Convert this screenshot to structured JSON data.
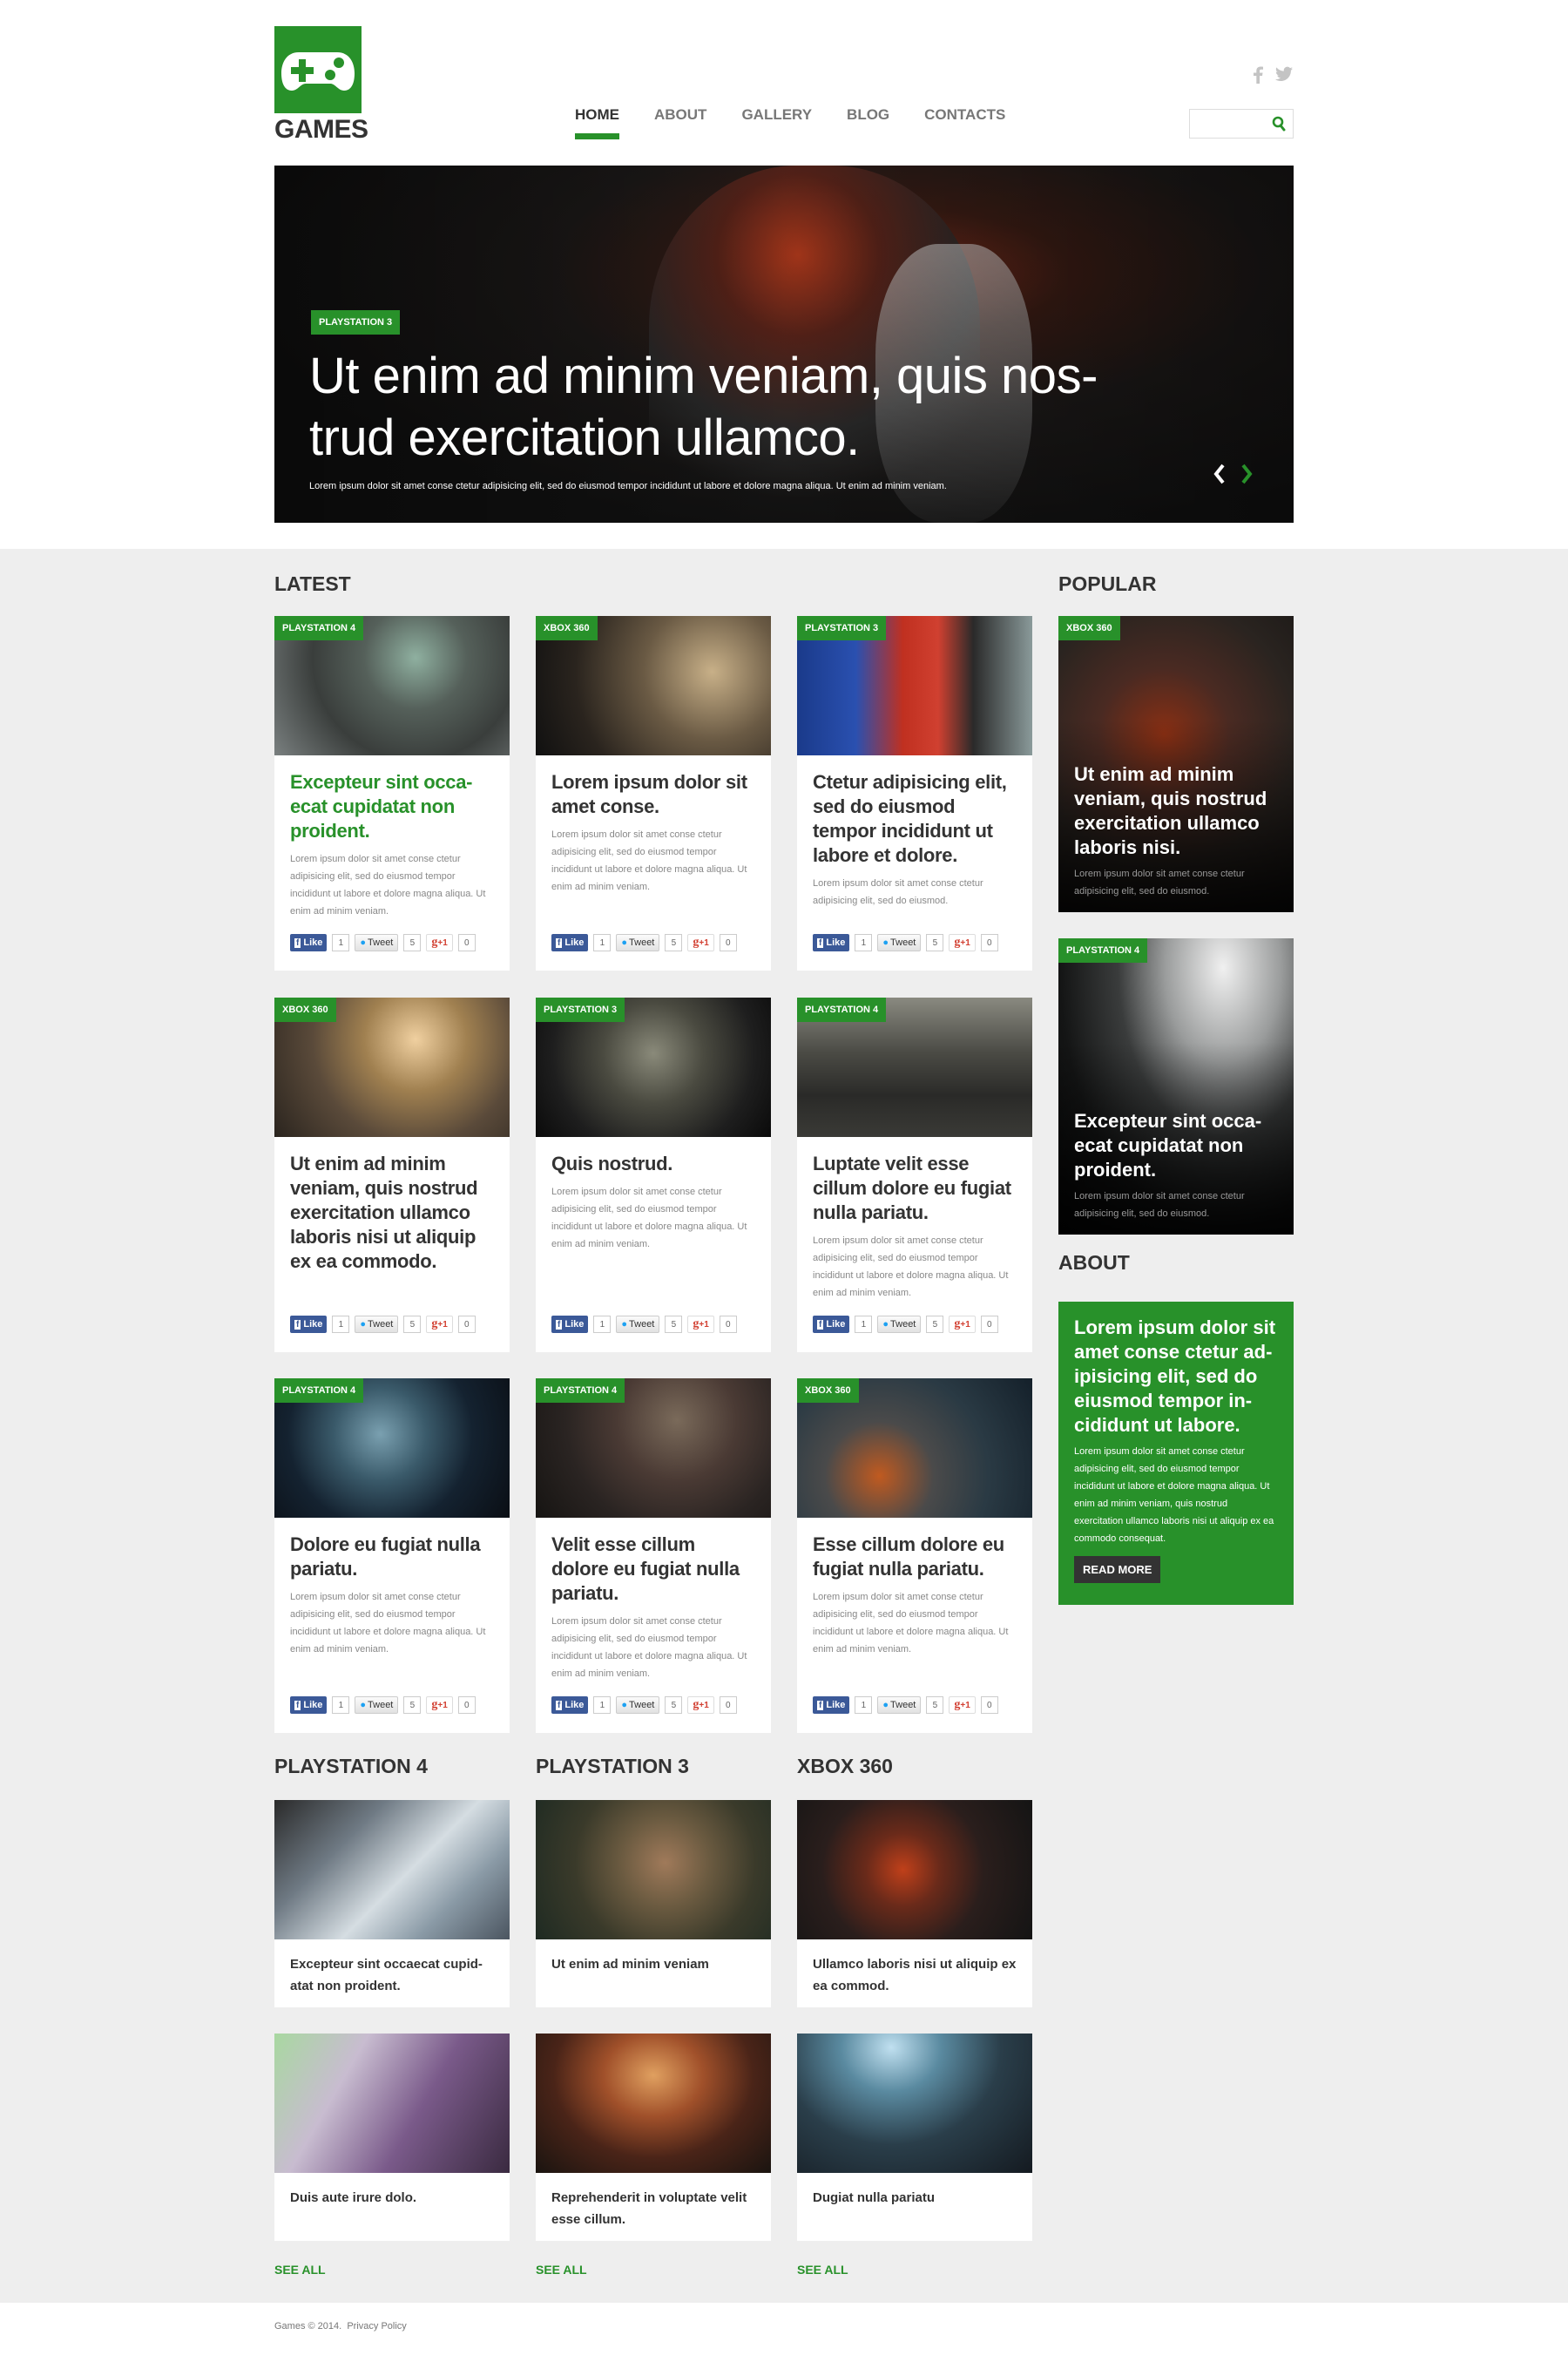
{
  "brand": {
    "name": "GAMES",
    "logo_icon": "gamepad-icon",
    "accent_color": "#28912a"
  },
  "nav": {
    "items": [
      {
        "label": "HOME",
        "active": true
      },
      {
        "label": "ABOUT",
        "active": false
      },
      {
        "label": "GALLERY",
        "active": false
      },
      {
        "label": "BLOG",
        "active": false
      },
      {
        "label": "CONTACTS",
        "active": false
      }
    ]
  },
  "social": [
    {
      "icon": "facebook-icon",
      "glyph": "f"
    },
    {
      "icon": "twitter-icon",
      "glyph": "t"
    }
  ],
  "search": {
    "value": "",
    "placeholder": "",
    "icon": "search-icon"
  },
  "hero": {
    "badge": "PLAYSTATION 3",
    "title": "Ut enim ad minim veniam, quis nos-trud exercitation ullamco.",
    "title_line1": "Ut enim ad minim veniam, quis nos-",
    "title_line2": "trud exercitation ullamco.",
    "subtitle": "Lorem ipsum dolor sit amet conse ctetur adipisicing elit, sed do eiusmod tempor incididunt ut labore et dolore magna aliqua. Ut enim ad minim veniam.",
    "prev_arrow": "‹",
    "next_arrow": "›"
  },
  "latest": {
    "title": "LATEST",
    "share": {
      "like_label": "Like",
      "like_count": "1",
      "tweet_label": "Tweet",
      "tweet_count": "5",
      "gplus_label": "+1",
      "gplus_count": "0"
    },
    "cards": [
      {
        "badge": "PLAYSTATION 4",
        "title": "Excepteur sint occa-ecat cupidatat non proident.",
        "highlight": true,
        "text": "Lorem ipsum dolor sit amet conse ctetur adipisicing elit, sed do eiusmod tempor incididunt ut labore et dolore magna aliqua. Ut enim ad minim veniam."
      },
      {
        "badge": "XBOX 360",
        "title": "Lorem ipsum dolor sit amet conse.",
        "highlight": false,
        "text": "Lorem ipsum dolor sit amet conse ctetur adipisicing elit, sed do eiusmod tempor incididunt ut labore et dolore magna aliqua. Ut enim ad minim veniam."
      },
      {
        "badge": "PLAYSTATION 3",
        "title": "Ctetur adipisicing elit, sed do eiusmod tempor incididunt ut labore et dolore.",
        "highlight": false,
        "text": "Lorem ipsum dolor sit amet conse ctetur adipisicing elit, sed do eiusmod."
      },
      {
        "badge": "XBOX 360",
        "title": "Ut enim ad minim veniam, quis nostrud exercitation ullamco laboris nisi ut aliquip ex ea commodo.",
        "highlight": false,
        "text": ""
      },
      {
        "badge": "PLAYSTATION 3",
        "title": "Quis nostrud.",
        "highlight": false,
        "text": "Lorem ipsum dolor sit amet conse ctetur adipisicing elit, sed do eiusmod tempor incididunt ut labore et dolore magna aliqua. Ut enim ad minim veniam."
      },
      {
        "badge": "PLAYSTATION 4",
        "title": "Luptate velit esse cillum dolore eu fugiat nulla pariatu.",
        "highlight": false,
        "text": "Lorem ipsum dolor sit amet conse ctetur adipisicing elit, sed do eiusmod tempor incididunt ut labore et dolore magna aliqua. Ut enim ad minim veniam."
      },
      {
        "badge": "PLAYSTATION 4",
        "title": "Dolore eu fugiat nulla pariatu.",
        "highlight": false,
        "text": "Lorem ipsum dolor sit amet conse ctetur adipisicing elit, sed do eiusmod tempor incididunt ut labore et dolore magna aliqua. Ut enim ad minim veniam."
      },
      {
        "badge": "PLAYSTATION 4",
        "title": "Velit esse cillum dolore eu fugiat nulla pariatu.",
        "highlight": false,
        "text": "Lorem ipsum dolor sit amet conse ctetur adipisicing elit, sed do eiusmod tempor incididunt ut labore et dolore magna aliqua. Ut enim ad minim veniam."
      },
      {
        "badge": "XBOX 360",
        "title": "Esse cillum dolore eu fugiat nulla pariatu.",
        "highlight": false,
        "text": "Lorem ipsum dolor sit amet conse ctetur adipisicing elit, sed do eiusmod tempor incididunt ut labore et dolore magna aliqua. Ut enim ad minim veniam."
      }
    ]
  },
  "popular": {
    "title": "POPULAR",
    "cards": [
      {
        "badge": "XBOX 360",
        "title": "Ut enim ad minim veniam, quis nostrud exercitation ullamco laboris nisi.",
        "text": "Lorem ipsum dolor sit amet conse ctetur adipisicing elit, sed do eiusmod."
      },
      {
        "badge": "PLAYSTATION 4",
        "title": "Excepteur sint occa-ecat cupidatat non proident.",
        "text": "Lorem ipsum dolor sit amet conse ctetur adipisicing elit, sed do eiusmod."
      }
    ]
  },
  "about": {
    "title": "ABOUT",
    "heading": "Lorem ipsum dolor sit amet conse ctetur ad-ipisicing elit, sed do eiusmod tempor in-cididunt ut labore.",
    "text": "Lorem ipsum dolor sit amet conse ctetur adipisicing elit, sed do eiusmod tempor incididunt ut labore et dolore magna aliqua. Ut enim ad minim veniam, quis nostrud exercitation ullamco laboris nisi ut aliquip ex ea commodo consequat.",
    "button": "READ MORE"
  },
  "categories": [
    {
      "title": "PLAYSTATION 4",
      "items": [
        "Excepteur sint occaecat cupid-atat non proident.",
        "Duis aute irure dolo."
      ],
      "see_all": "SEE ALL"
    },
    {
      "title": "PLAYSTATION 3",
      "items": [
        "Ut enim ad minim veniam",
        "Reprehenderit in voluptate velit esse cillum."
      ],
      "see_all": "SEE ALL"
    },
    {
      "title": "XBOX 360",
      "items": [
        "Ullamco laboris nisi ut aliquip ex ea commod.",
        "Dugiat nulla pariatu"
      ],
      "see_all": "SEE ALL"
    }
  ],
  "footer": {
    "copyright": "Games © 2014.",
    "privacy": "Privacy Policy"
  }
}
